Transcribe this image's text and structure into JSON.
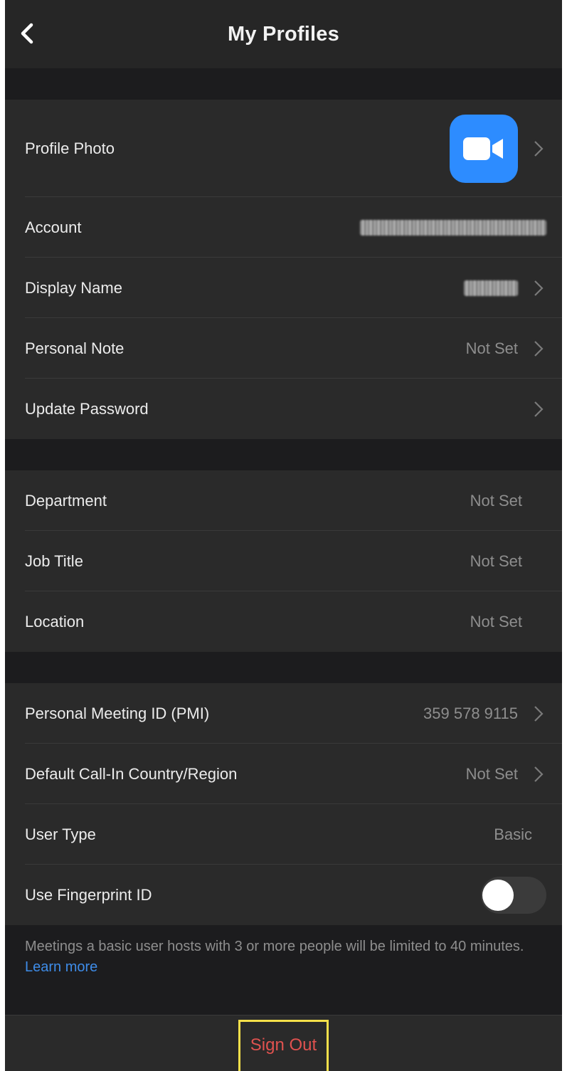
{
  "header": {
    "title": "My Profiles"
  },
  "section1": {
    "profile_photo": {
      "label": "Profile Photo"
    },
    "account": {
      "label": "Account"
    },
    "display_name": {
      "label": "Display Name"
    },
    "personal_note": {
      "label": "Personal Note",
      "value": "Not Set"
    },
    "update_password": {
      "label": "Update Password"
    }
  },
  "section2": {
    "department": {
      "label": "Department",
      "value": "Not Set"
    },
    "job_title": {
      "label": "Job Title",
      "value": "Not Set"
    },
    "location": {
      "label": "Location",
      "value": "Not Set"
    }
  },
  "section3": {
    "pmi": {
      "label": "Personal Meeting ID (PMI)",
      "value": "359 578 9115"
    },
    "call_in": {
      "label": "Default Call-In Country/Region",
      "value": "Not Set"
    },
    "user_type": {
      "label": "User Type",
      "value": "Basic"
    },
    "fingerprint": {
      "label": "Use Fingerprint ID",
      "enabled": false
    }
  },
  "note": {
    "text": "Meetings a basic user hosts with 3 or more people will be limited to 40 minutes.",
    "link": "Learn more"
  },
  "footer": {
    "sign_out": "Sign Out"
  },
  "colors": {
    "background": "#1c1c1e",
    "row_background": "#2a2a2a",
    "zoom_blue": "#2d8cff",
    "link_blue": "#3e8ce8",
    "sign_out_red": "#e0524f",
    "highlight_yellow": "#f5e04a"
  },
  "icons": [
    "back-arrow-icon",
    "chevron-right-icon",
    "zoom-camera-icon"
  ]
}
